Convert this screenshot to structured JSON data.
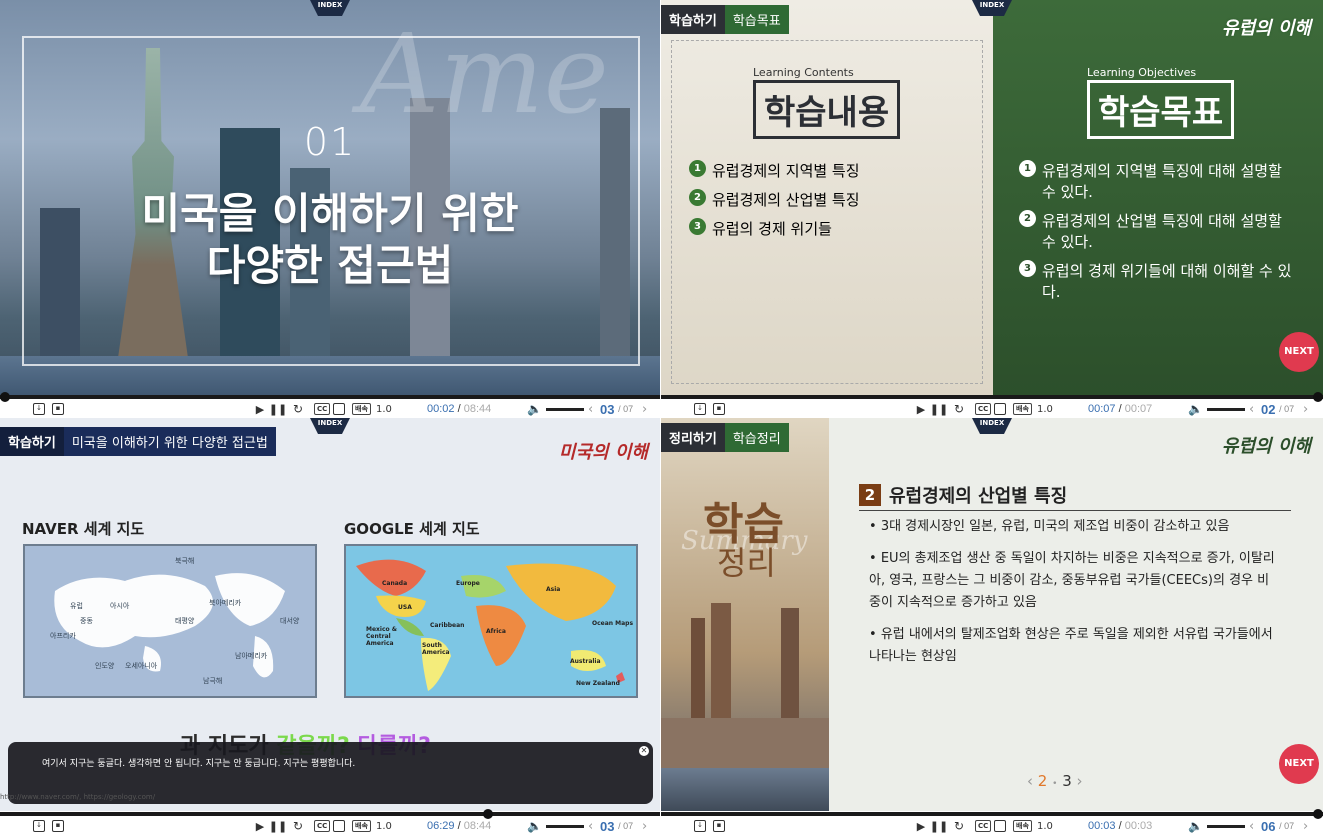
{
  "controls": {
    "p1": {
      "time_cur": "00:02",
      "time_tot": "08:44",
      "page": "03",
      "pages": "07",
      "speed": "1.0",
      "seek_fraction": 0.004
    },
    "p2": {
      "time_cur": "00:07",
      "time_tot": "00:07",
      "page": "02",
      "pages": "07",
      "speed": "1.0",
      "seek_fraction": 1.0
    },
    "p3": {
      "time_cur": "06:29",
      "time_tot": "08:44",
      "page": "03",
      "pages": "07",
      "speed": "1.0",
      "seek_fraction": 0.74
    },
    "p4": {
      "time_cur": "00:03",
      "time_tot": "00:03",
      "page": "06",
      "pages": "07",
      "speed": "1.0",
      "seek_fraction": 1.0
    },
    "cc_label": "CC",
    "script_label": "배속",
    "index_label": "INDEX"
  },
  "p1": {
    "script_text": "Ame",
    "number": "01",
    "title_line1": "미국을 이해하기 위한",
    "title_line2": "다양한 접근법"
  },
  "p2": {
    "crumb_a": "학습하기",
    "crumb_b": "학습목표",
    "logo": "유럽의 이해",
    "contents_en": "Learning Contents",
    "contents_ko": "학습내용",
    "objectives_en": "Learning Objectives",
    "objectives_ko": "학습목표",
    "contents": [
      "유럽경제의 지역별 특징",
      "유럽경제의 산업별 특징",
      "유럽의 경제 위기들"
    ],
    "objectives": [
      "유럽경제의 지역별 특징에 대해 설명할 수 있다.",
      "유럽경제의 산업별 특징에 대해 설명할 수 있다.",
      "유럽의 경제 위기들에 대해 이해할 수 있다."
    ],
    "next": "NEXT"
  },
  "p3": {
    "crumb_a": "학습하기",
    "crumb_b": "미국을 이해하기 위한 다양한 접근법",
    "logo": "미국의 이해",
    "naver_title": "NAVER 세계 지도",
    "google_title": "GOOGLE 세계 지도",
    "naver_labels": [
      "북극해",
      "유럽",
      "아시아",
      "북아메리카",
      "태평양",
      "대서양",
      "중동",
      "아프리카",
      "인도양",
      "오세아니아",
      "남아메리카",
      "남극해"
    ],
    "google_labels": [
      "Canada",
      "Europe",
      "Asia",
      "USA",
      "Caribbean",
      "Mexico & Central America",
      "Africa",
      "Ocean Maps",
      "South America",
      "Australia",
      "New Zealand"
    ],
    "overlay_q1": "과 지도가",
    "overlay_q2": "같을까?",
    "overlay_q3": "다를까?",
    "subtitle": "여기서 지구는 둥글다. 생각하면 안 됩니다. 지구는 안 둥급니다. 지구는 평평합니다.",
    "source": "http://www.naver.com/, https://geology.com/"
  },
  "p4": {
    "crumb_a": "정리하기",
    "crumb_b": "학습정리",
    "logo": "유럽의 이해",
    "summary_ko1": "학습",
    "summary_ko2": "정리",
    "summary_en": "Summary",
    "section_num": "2",
    "section_title": "유럽경제의 산업별 특징",
    "points": [
      "3대 경제시장인 일본, 유럽, 미국의 제조업 비중이 감소하고 있음",
      "EU의 총제조업 생산 중 독일이 차지하는 비중은 지속적으로 증가, 이탈리아, 영국, 프랑스는 그 비중이 감소, 중동부유럽 국가들(CEECs)의 경우 비중이 지속적으로 증가하고 있음",
      "유럽 내에서의 탈제조업화 현상은 주로 독일을 제외한 서유럽 국가들에서 나타나는 현상임"
    ],
    "pager_prev": "‹",
    "pager_cur": "2",
    "pager_dot": "•",
    "pager_next_num": "3",
    "pager_next": "›",
    "next": "NEXT"
  }
}
